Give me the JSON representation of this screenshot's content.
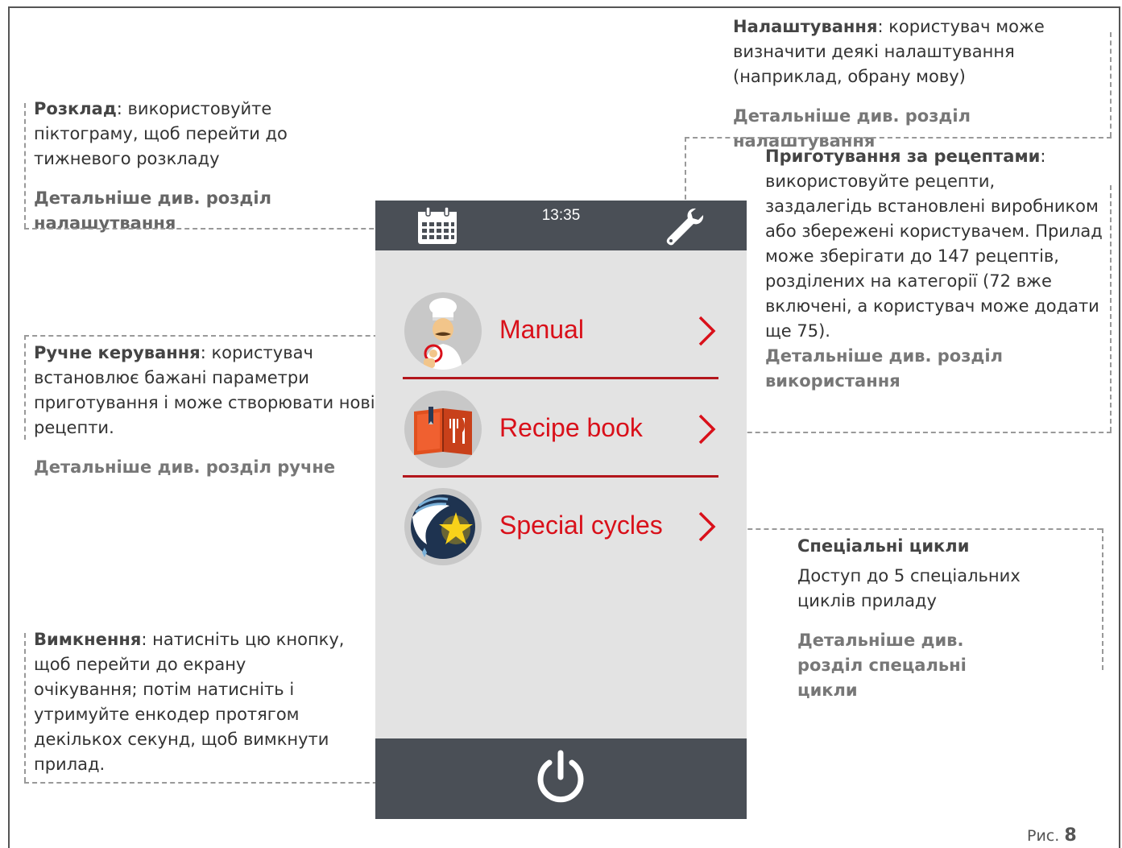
{
  "screen": {
    "time": "13:35",
    "menu": [
      {
        "label": "Manual",
        "icon": "chef-icon"
      },
      {
        "label": "Recipe book",
        "icon": "recipe-book-icon"
      },
      {
        "label": "Special cycles",
        "icon": "special-cycles-icon"
      }
    ],
    "colors": {
      "bar": "#4a4f56",
      "panel": "#e3e3e3",
      "accent": "#d9101a",
      "separator": "#b3161c"
    }
  },
  "annotations": {
    "settings": {
      "title": "Налаштування",
      "text": ": користувач може визначити деякі налаштування (наприклад, обрану мову)",
      "more": "Детальніше див. розділ налаштування"
    },
    "schedule": {
      "title": "Розклад",
      "text": ": використовуйте піктограму, щоб перейти до тижневого розкладу",
      "more": "Детальніше див. розділ налашутвання"
    },
    "recipes": {
      "title": "Приготування за рецептами",
      "text": ": використовуйте рецепти, заздалегідь встановлені виробником або збережені користувачем. Прилад може зберігати до 147 рецептів, розділених на категорії (72 вже включені, а користувач може додати ще 75).",
      "more": "Детальніше див. розділ використання"
    },
    "manual": {
      "title": "Ручне керування",
      "text": ": користувач встановлює бажані параметри приготування і може створювати нові рецепти.",
      "more": "Детальніше див. розділ ручне"
    },
    "special": {
      "title": "Спеціальні цикли",
      "text": "Доступ до 5 спеціальних циклів приладу",
      "more": "Детальніше див. розділ спецальні цикли"
    },
    "power": {
      "title": "Вимкнення",
      "text": ": натисніть цю кнопку, щоб перейти до екрану очікування; потім натисніть і утримуйте енкодер протягом декількох секунд, щоб вимкнути прилад."
    }
  },
  "figure": {
    "prefix": "Рис.",
    "number": "8"
  }
}
